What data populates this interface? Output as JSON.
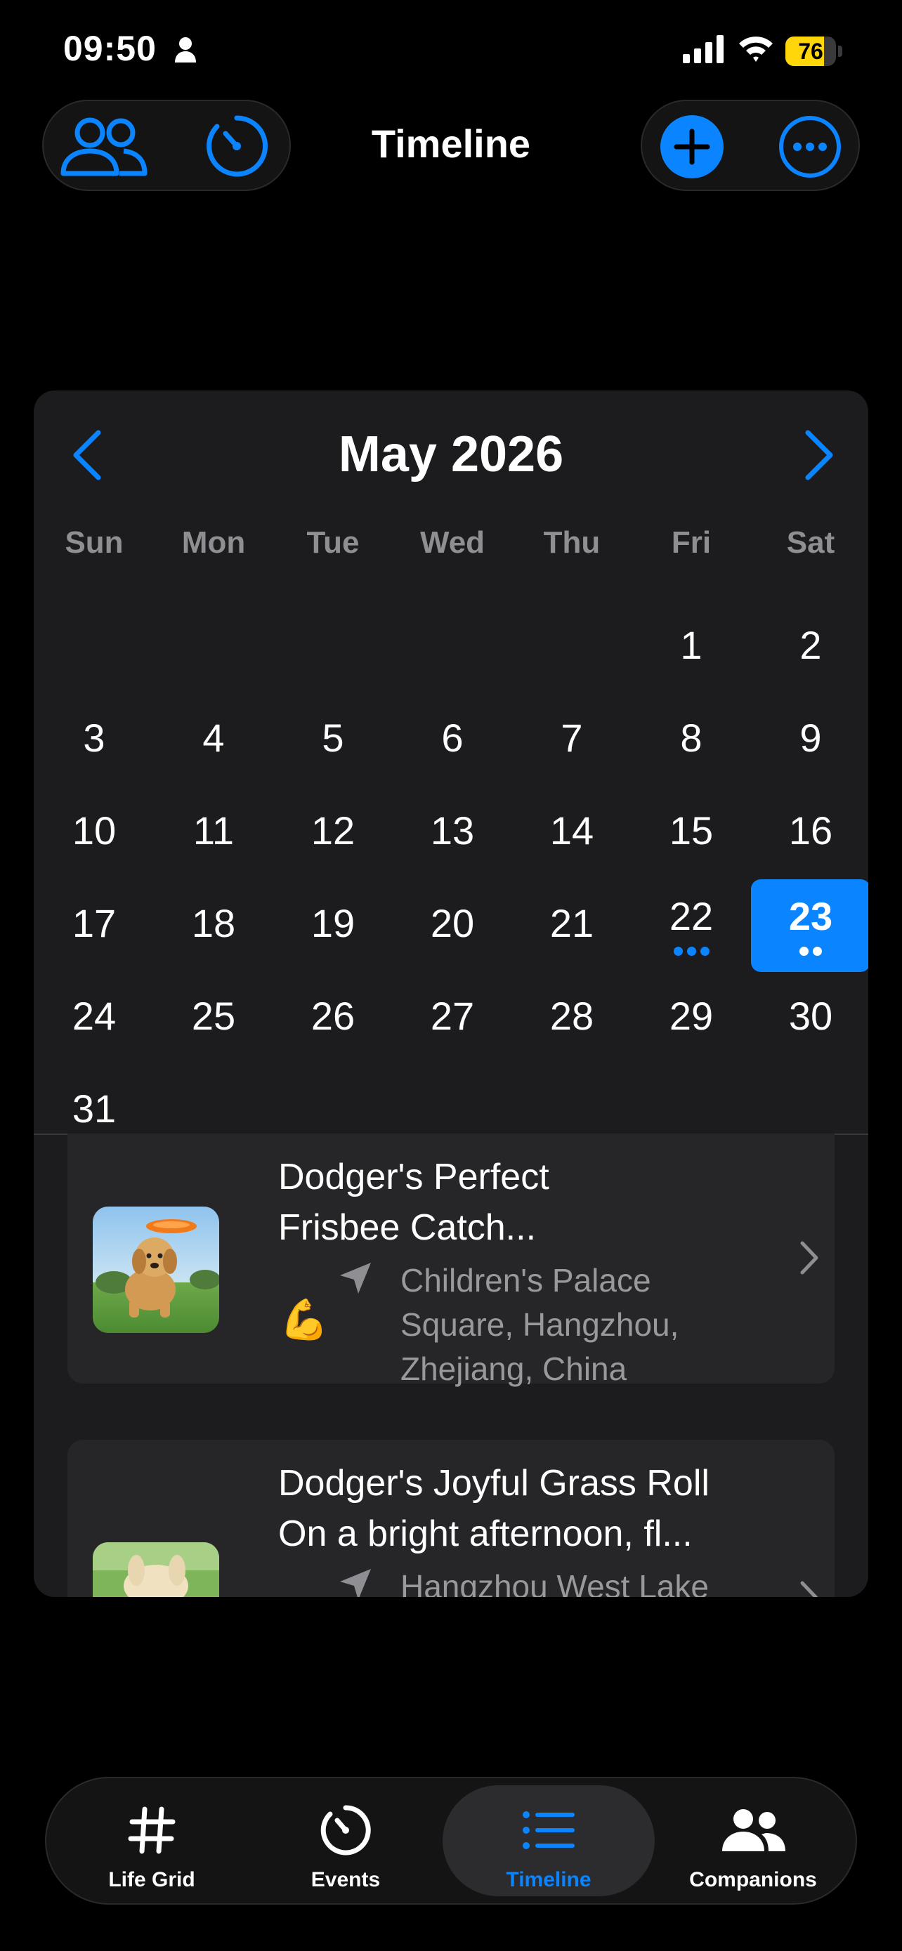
{
  "status_bar": {
    "time": "09:50",
    "battery_level": 76,
    "battery_text": "76"
  },
  "nav": {
    "title": "Timeline",
    "left_icons": [
      "companions-icon",
      "timer-icon"
    ],
    "right_icons": [
      "add-icon",
      "more-icon"
    ]
  },
  "calendar": {
    "month_title": "May 2026",
    "weekdays": [
      "Sun",
      "Mon",
      "Tue",
      "Wed",
      "Thu",
      "Fri",
      "Sat"
    ],
    "first_weekday_index": 5,
    "days_in_month": 31,
    "selected_day": 23,
    "days_with_events": [
      {
        "day": 22,
        "dot_count": 3
      },
      {
        "day": 23,
        "dot_count": 2
      }
    ]
  },
  "entries": [
    {
      "title_lines": [
        "Dodger's Perfect",
        "Frisbee Catch..."
      ],
      "location_lines": [
        "Children's Palace",
        "Square, Hangzhou,",
        "Zhejiang, China"
      ],
      "emoji": "💪",
      "thumbnail": "dog-frisbee-photo"
    },
    {
      "title_lines": [
        "Dodger's Joyful Grass Roll",
        "On a bright afternoon, fl..."
      ],
      "location_lines": [
        "Hangzhou West Lake"
      ],
      "thumbnail": "dog-grass-photo"
    }
  ],
  "tabbar": {
    "tabs": [
      {
        "label": "Life Grid",
        "icon": "hashtag-icon",
        "active": false
      },
      {
        "label": "Events",
        "icon": "timer-icon",
        "active": false
      },
      {
        "label": "Timeline",
        "icon": "list-icon",
        "active": true
      },
      {
        "label": "Companions",
        "icon": "people-icon",
        "active": false
      }
    ]
  },
  "colors": {
    "accent": "#0a84ff",
    "background": "#000000",
    "card": "#1c1c1e",
    "battery": "#ffd60a",
    "secondary_text": "#8e8e93"
  }
}
